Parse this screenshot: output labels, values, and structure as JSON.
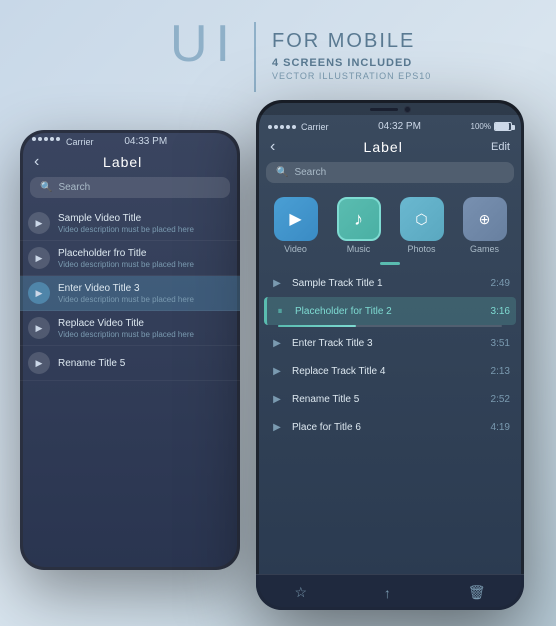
{
  "header": {
    "ui_letters": "UI",
    "divider": "|",
    "for_mobile": "FOR MOBILE",
    "screens_included": "4 SCREENS INCLUDED",
    "vector_text": "VECTOR ILLUSTRATION EPS10"
  },
  "left_phone": {
    "status": {
      "carrier": "Carrier",
      "time": "04:33 PM"
    },
    "nav": {
      "back": "‹",
      "title": "Label"
    },
    "search": {
      "icon": "🔍",
      "placeholder": "Search"
    },
    "tracks": [
      {
        "title": "Sample Video Title",
        "desc": "Video description must be placed here",
        "active": false
      },
      {
        "title": "Placeholder fro Title",
        "desc": "Video description must be placed here",
        "active": false
      },
      {
        "title": "Enter Video Title 3",
        "desc": "Video description must be placed here",
        "active": true
      },
      {
        "title": "Replace Video Title",
        "desc": "Video description must be placed here",
        "active": false
      },
      {
        "title": "Rename Title 5",
        "desc": "",
        "active": false
      }
    ]
  },
  "right_phone": {
    "status": {
      "carrier": "Carrier",
      "time": "04:32 PM",
      "battery": "100%"
    },
    "nav": {
      "back": "‹",
      "title": "Label",
      "edit": "Edit"
    },
    "search": {
      "placeholder": "Search"
    },
    "categories": [
      {
        "label": "Video",
        "icon": "▶",
        "style": "video"
      },
      {
        "label": "Music",
        "icon": "♪",
        "style": "music"
      },
      {
        "label": "Photos",
        "icon": "📷",
        "style": "photos"
      },
      {
        "label": "Games",
        "icon": "🎮",
        "style": "games"
      }
    ],
    "tracks": [
      {
        "title": "Sample Track Title 1",
        "duration": "2:49",
        "state": "play"
      },
      {
        "title": "Placeholder for Title 2",
        "duration": "3:16",
        "state": "pause"
      },
      {
        "title": "Enter Track Title 3",
        "duration": "3:51",
        "state": "play"
      },
      {
        "title": "Replace Track Title 4",
        "duration": "2:13",
        "state": "play"
      },
      {
        "title": "Rename Title 5",
        "duration": "2:52",
        "state": "play"
      },
      {
        "title": "Place for Title 6",
        "duration": "4:19",
        "state": "play"
      }
    ],
    "bottom_icons": [
      "☆",
      "↑",
      "🗑"
    ]
  }
}
